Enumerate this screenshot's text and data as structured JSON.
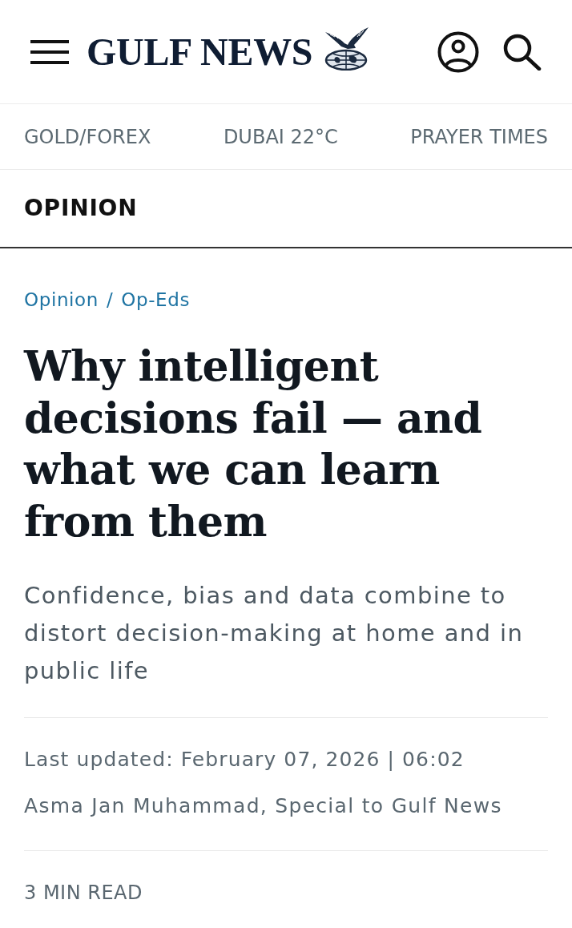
{
  "header": {
    "logo": "GULF NEWS"
  },
  "quick_links": [
    "GOLD/FOREX",
    "DUBAI 22°C",
    "PRAYER TIMES"
  ],
  "section": {
    "title": "OPINION"
  },
  "article": {
    "breadcrumb": {
      "items": [
        "Opinion",
        "Op-Eds"
      ],
      "separator": "/"
    },
    "headline": "Why intelligent decisions fail — and what we can learn from them",
    "summary": "Confidence, bias and data combine to distort decision-making at home and in public life",
    "last_updated": "Last updated: February 07, 2026 | 06:02",
    "byline": "Asma Jan Muhammad, Special to Gulf News",
    "read_time": "3 MIN READ"
  }
}
